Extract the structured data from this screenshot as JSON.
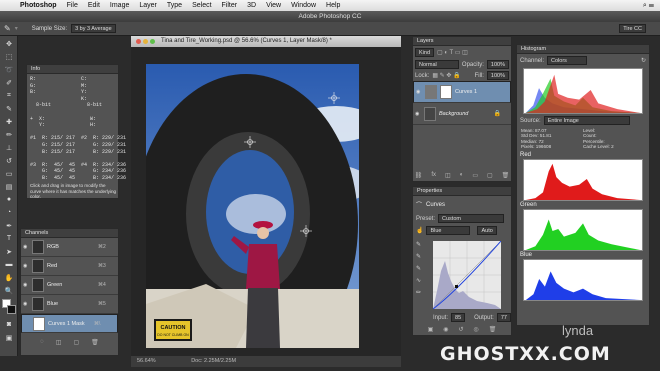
{
  "menubar": {
    "app": "Photoshop",
    "items": [
      "File",
      "Edit",
      "Image",
      "Layer",
      "Type",
      "Select",
      "Filter",
      "3D",
      "View",
      "Window",
      "Help"
    ]
  },
  "app_title": "Adobe Photoshop CC",
  "options": {
    "sample_size_label": "Sample Size:",
    "sample_size_value": "3 by 3 Average",
    "workspace": "Tire CC"
  },
  "document": {
    "title": "Tina and Tire_Working.psd @ 56.6% (Curves 1, Layer Mask/8) *",
    "zoom": "56.64%",
    "doc_size": "Doc: 2.25M/2.25M"
  },
  "info": {
    "tab": "Info",
    "col1": "R:\nG:\nB:\n\n  8-bit\n\n+  X:\n   Y:\n\n#1  R: 215/ 217\n    G: 215/ 217\n    B: 215/ 217\n\n#3  R:  45/  45\n    G:  45/  45\n    B:  45/  45",
    "col2": "C:\nM:\nY:\nK:\n  8-bit\n\n   W:\n   H:\n\n#2  R: 229/ 231\n    G: 229/ 231\n    B: 229/ 231\n\n#4  R: 234/ 236\n    G: 234/ 236\n    B: 234/ 236",
    "hint": "Click and drag in image to modify the curve where it has matches the underlying color."
  },
  "channels": {
    "tab": "Channels",
    "rows": [
      {
        "name": "RGB",
        "key": "⌘2"
      },
      {
        "name": "Red",
        "key": "⌘3"
      },
      {
        "name": "Green",
        "key": "⌘4"
      },
      {
        "name": "Blue",
        "key": "⌘5"
      },
      {
        "name": "Curves 1 Mask",
        "key": "⌘\\"
      }
    ]
  },
  "layers": {
    "tab": "Layers",
    "kind": "Kind",
    "mode": "Normal",
    "opacity_label": "Opacity:",
    "opacity": "100%",
    "lock_label": "Lock:",
    "fill_label": "Fill:",
    "fill": "100%",
    "rows": [
      {
        "name": "Curves 1"
      },
      {
        "name": "Background"
      }
    ]
  },
  "properties": {
    "tab": "Properties",
    "adjustment": "Curves",
    "preset_label": "Preset:",
    "preset": "Custom",
    "channel": "Blue",
    "auto": "Auto",
    "input_label": "Input:",
    "input": "85",
    "output_label": "Output:",
    "output": "77"
  },
  "histogram": {
    "tab": "Histogram",
    "channel_label": "Channel:",
    "channel": "Colors",
    "source_label": "Source:",
    "source": "Entire Image",
    "stats": [
      [
        "Mean: 87.07",
        "Level:"
      ],
      [
        "Std Dev: 51.81",
        "Count:"
      ],
      [
        "Median: 72",
        "Percentile:"
      ],
      [
        "Pixels: 196608",
        "Cache Level: 2"
      ]
    ],
    "labels": [
      "Red",
      "Green",
      "Blue"
    ]
  },
  "watermark": "GHOSTXX.COM",
  "brand": "lynda",
  "colors": {
    "red": "#e01b1b",
    "green": "#22d022",
    "blue": "#1f3ee8",
    "selection": "#6f8eb0"
  }
}
